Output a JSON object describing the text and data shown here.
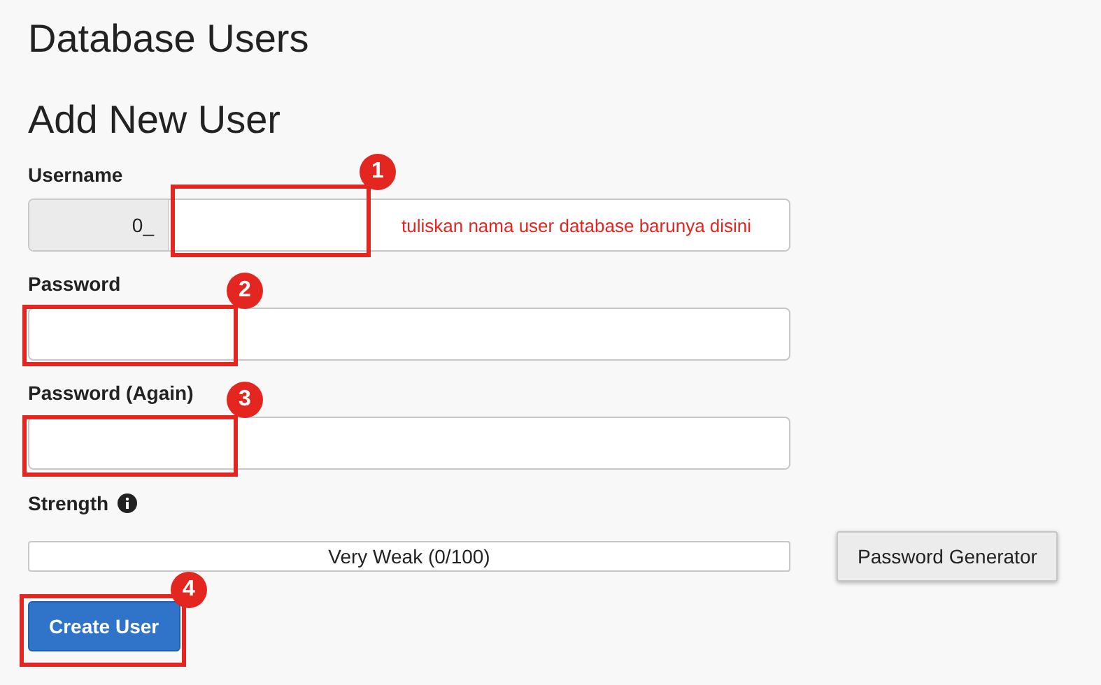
{
  "page_title": "Database Users",
  "section_title": "Add New User",
  "fields": [
    {
      "kind": "prefixed",
      "label": "Username",
      "prefix": "0_"
    },
    {
      "kind": "password",
      "label": "Password"
    },
    {
      "kind": "password",
      "label": "Password (Again)"
    }
  ],
  "hint": "tuliskan nama user database barunya disini",
  "strength": {
    "label": "Strength",
    "reading": "Very Weak (0/100)",
    "level": 0
  },
  "generator_button": "Password Generator",
  "submit_button": "Create User",
  "annotations": [
    {
      "number": "1"
    },
    {
      "number": "2"
    },
    {
      "number": "3"
    },
    {
      "number": "4"
    }
  ]
}
